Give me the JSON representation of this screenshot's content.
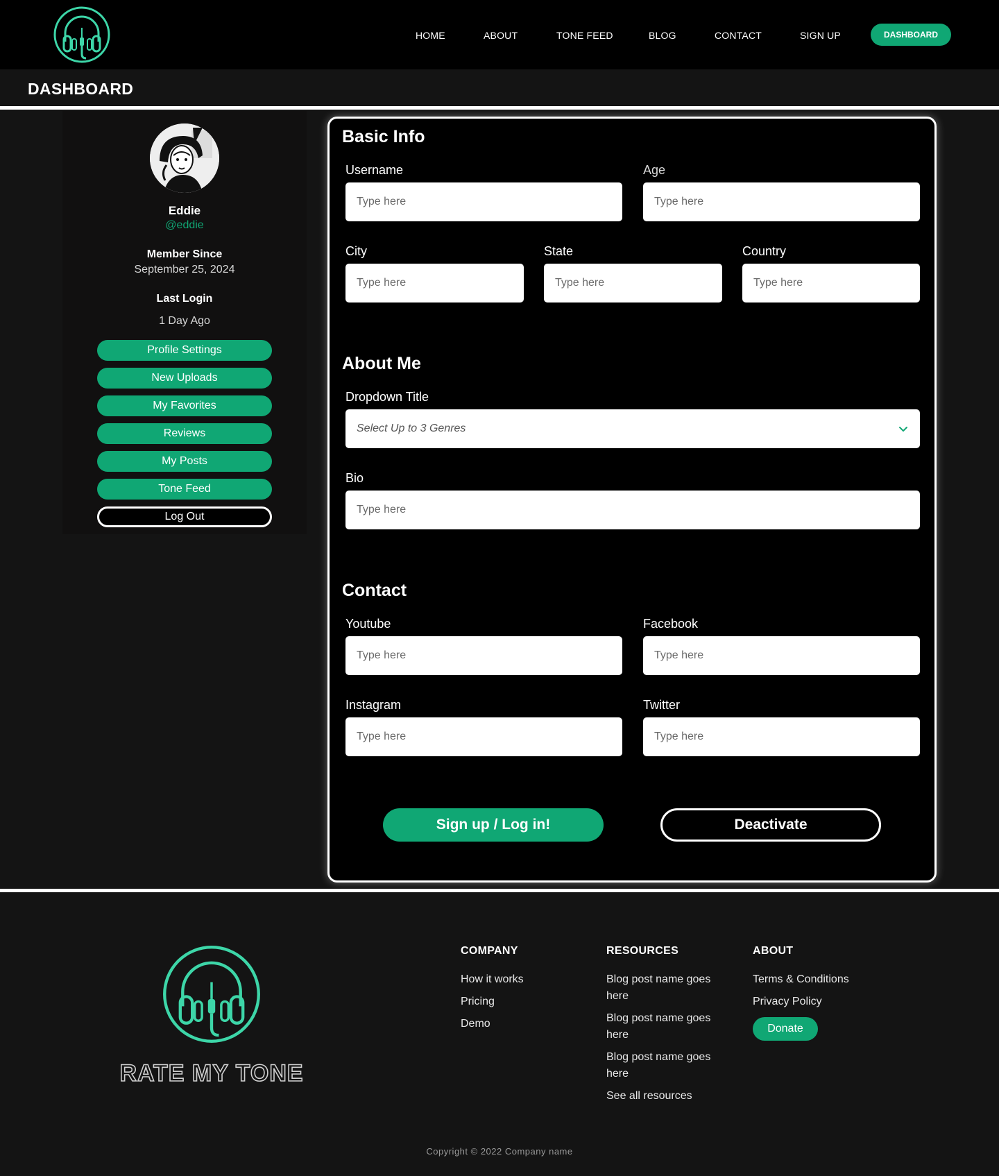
{
  "colors": {
    "accent": "#10a774",
    "logo": "#3dd6a8",
    "background": "#141414",
    "navbar": "#000000"
  },
  "nav": {
    "logo_icon": "headphones-logo-icon",
    "links": [
      "HOME",
      "ABOUT",
      "TONE FEED",
      "BLOG",
      "CONTACT",
      "SIGN UP"
    ],
    "cta": "DASHBOARD"
  },
  "page": {
    "title": "DASHBOARD"
  },
  "profile": {
    "name": "Eddie",
    "handle": "@eddie",
    "member_since_label": "Member Since",
    "member_since": "September 25, 2024",
    "last_login_label": "Last Login",
    "last_login": "1 Day Ago",
    "avatar_icon": "avatar-illustration-icon",
    "menu": [
      "Profile Settings",
      "New Uploads",
      "My Favorites",
      "Reviews",
      "My Posts",
      "Tone Feed"
    ],
    "logout": "Log Out"
  },
  "form": {
    "basic_info": {
      "title": "Basic Info",
      "username_label": "Username",
      "age_label": "Age",
      "city_label": "City",
      "state_label": "State",
      "country_label": "Country"
    },
    "about_me": {
      "title": "About Me",
      "dropdown_label": "Dropdown Title",
      "dropdown_value": "Select Up to 3 Genres",
      "bio_label": "Bio"
    },
    "contact": {
      "title": "Contact",
      "youtube_label": "Youtube",
      "facebook_label": "Facebook",
      "instagram_label": "Instagram",
      "twitter_label": "Twitter"
    },
    "placeholder": "Type here",
    "submit": "Sign up / Log in!",
    "deactivate": "Deactivate"
  },
  "footer": {
    "brand": "RATE MY TONE",
    "company": {
      "heading": "COMPANY",
      "links": [
        "How it works",
        "Pricing",
        "Demo"
      ]
    },
    "resources": {
      "heading": "RESOURCES",
      "links": [
        "Blog post name goes here",
        "Blog post name goes here",
        "Blog post name goes here",
        "See all resources"
      ]
    },
    "about": {
      "heading": "ABOUT",
      "links": [
        "Terms & Conditions",
        "Privacy Policy"
      ],
      "donate": "Donate"
    },
    "copyright": "Copyright © 2022 Company name"
  }
}
